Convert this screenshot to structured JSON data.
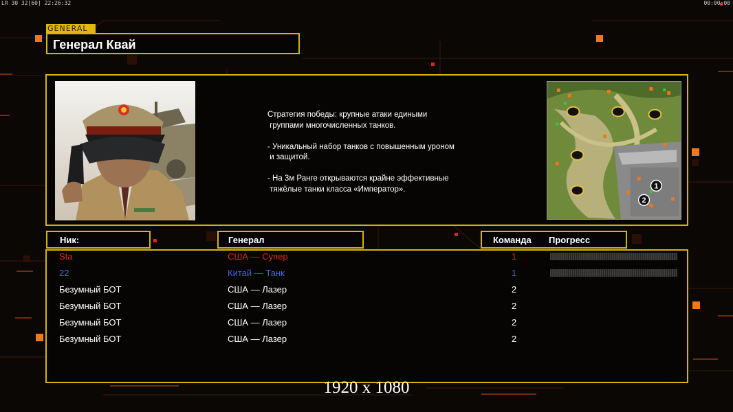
{
  "hud": {
    "left_stats": "LR 30 32[60] 22:26:32",
    "right_clock": "00:00:00"
  },
  "general": {
    "tag": "GENERAL",
    "name": "Генерал Квай",
    "description": "Стратегия победы: крупные атаки едиными\n группами многочисленных танков.\n\n- Уникальный набор танков с повышенным уроном\n и защитой.\n\n- На 3м Ранге открываются крайне эффективные\n тяжёлые танки класса «Император»."
  },
  "table": {
    "col_nick": "Ник:",
    "col_general": "Генерал",
    "col_team": "Команда",
    "col_progress": "Прогресс",
    "rows": [
      {
        "nick": "Sta",
        "general": "США — Супер",
        "team": "1",
        "color": "#e8201e",
        "progress": 0
      },
      {
        "nick": "22",
        "general": "Китай — Танк",
        "team": "1",
        "color": "#3f63f2",
        "progress": 0
      },
      {
        "nick": "Безумный БОТ",
        "general": "США — Лазер",
        "team": "2",
        "color": "#ffffff"
      },
      {
        "nick": "Безумный БОТ",
        "general": "США — Лазер",
        "team": "2",
        "color": "#ffffff"
      },
      {
        "nick": "Безумный БОТ",
        "general": "США — Лазер",
        "team": "2",
        "color": "#ffffff"
      },
      {
        "nick": "Безумный БОТ",
        "general": "США — Лазер",
        "team": "2",
        "color": "#ffffff"
      }
    ]
  },
  "map": {
    "start_positions": [
      "1",
      "2"
    ]
  },
  "overlay": {
    "resolution": "1920 x 1080"
  },
  "colors": {
    "frame": "#d8b40c",
    "accent_orange": "#ff7a1a",
    "red_dot": "#d8281c"
  }
}
